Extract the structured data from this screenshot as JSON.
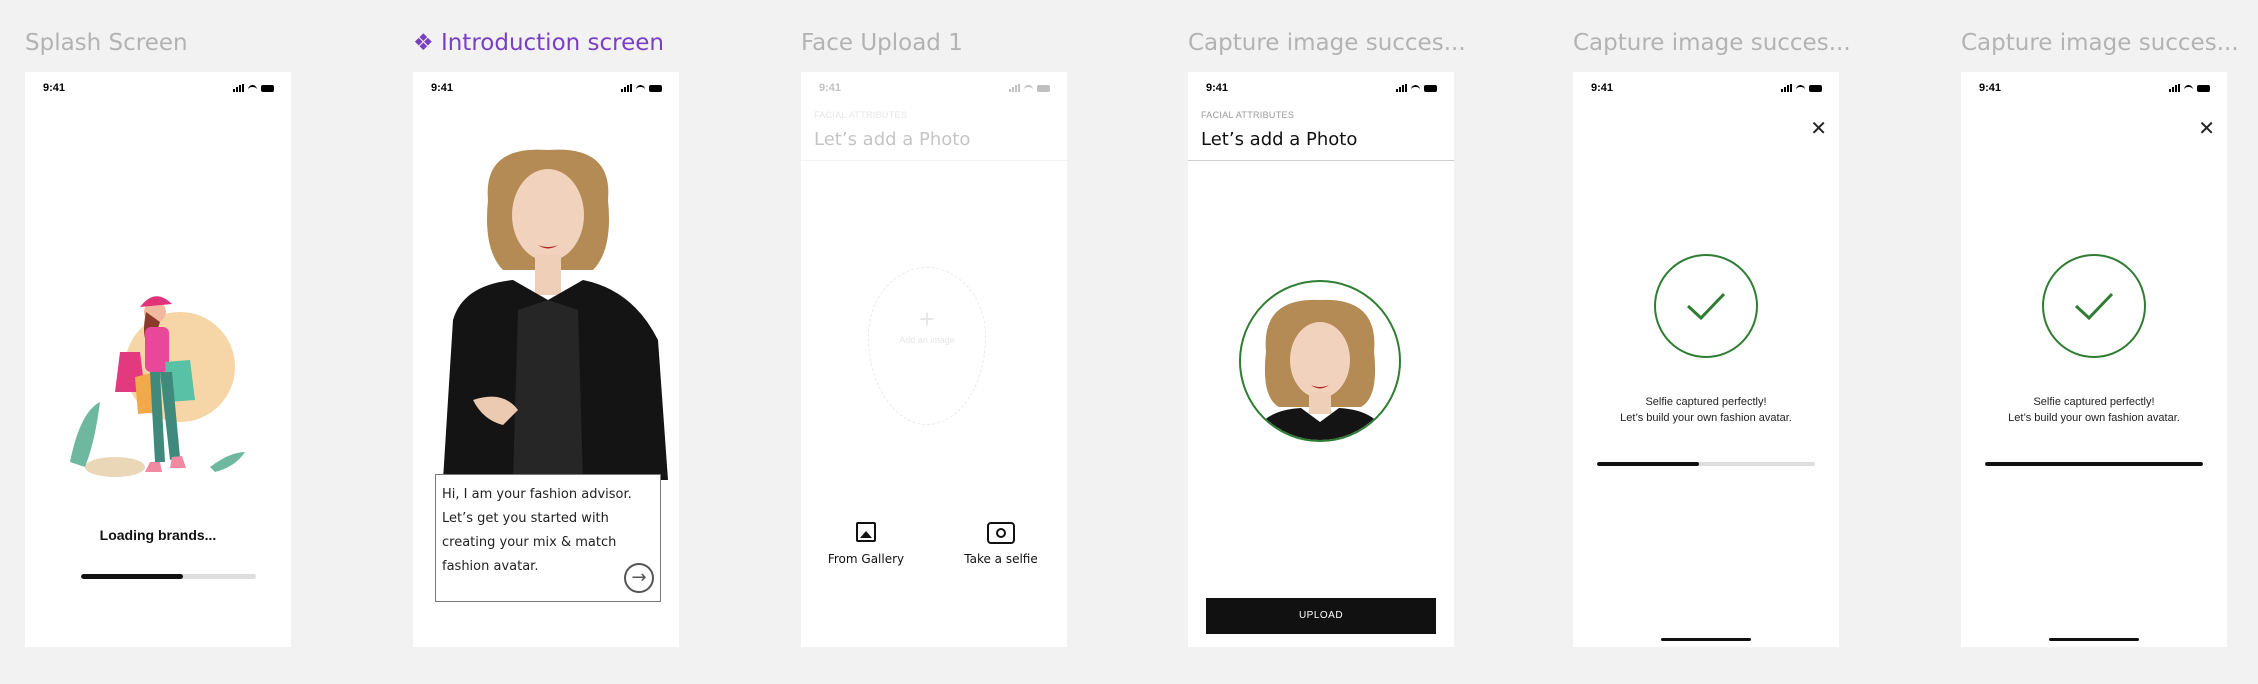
{
  "frames": [
    {
      "title": "Splash Screen"
    },
    {
      "title": "Introduction screen",
      "prefix_icon": "component-icon"
    },
    {
      "title": "Face Upload 1"
    },
    {
      "title": "Capture image succes..."
    },
    {
      "title": "Capture image succes..."
    },
    {
      "title": "Capture image succes..."
    }
  ],
  "status_time": "9:41",
  "splash": {
    "loading_text": "Loading brands...",
    "progress": 0.58
  },
  "intro": {
    "message": "Hi, I am your fashion advisor. Let’s get you started with creating your mix & match fashion avatar.",
    "next_icon": "arrow-right-icon"
  },
  "face_upload": {
    "subtitle": "FACIAL ATTRIBUTES",
    "title": "Let’s add a Photo",
    "add_image_label": "Add an image",
    "gallery_label": "From Gallery",
    "selfie_label": "Take a selfie"
  },
  "capture_preview": {
    "subtitle": "FACIAL ATTRIBUTES",
    "title": "Let’s add a Photo",
    "upload_label": "UPLOAD"
  },
  "capture_success": {
    "line1": "Selfie captured perfectly!",
    "line2": "Let’s build your own fashion avatar.",
    "progress_a": 0.47,
    "progress_b": 1.0
  },
  "colors": {
    "accent": "#7b3fc4",
    "success": "#2e7d32",
    "background": "#f2f2f2"
  }
}
